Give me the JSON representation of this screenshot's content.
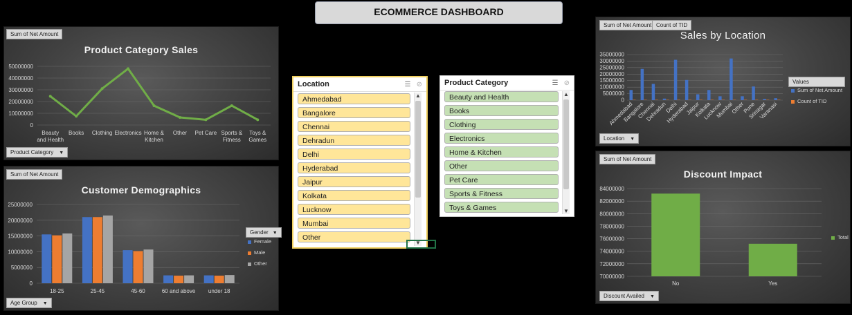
{
  "dashboard_title": "ECOMMERCE DASHBOARD",
  "colors": {
    "female": "#4472c4",
    "male": "#ed7d31",
    "other": "#a5a5a5",
    "line": "#70ad47",
    "bar_green": "#70ad47",
    "location_bar": "#4472c4",
    "count_tid": "#ed7d31",
    "slicer_location": "#ffe699",
    "slicer_category": "#c5e0b4"
  },
  "product_chart": {
    "field_button": "Sum of Net Amount",
    "title": "Product Category Sales",
    "filter_button": "Product Category",
    "y_ticks": [
      "50000000",
      "40000000",
      "30000000",
      "20000000",
      "10000000",
      "0"
    ],
    "x_labels": [
      [
        "Beauty",
        "and Health"
      ],
      [
        "Books"
      ],
      [
        "Clothing"
      ],
      [
        "Electronics"
      ],
      [
        "Home &",
        "Kitchen"
      ],
      [
        "Other"
      ],
      [
        "Pet Care"
      ],
      [
        "Sports &",
        "Fitness"
      ],
      [
        "Toys &",
        "Games"
      ]
    ]
  },
  "demographics_chart": {
    "field_button": "Sum of Net Amount",
    "title": "Customer Demographics",
    "filter_button": "Age Group",
    "legend_title": "Gender",
    "legend": [
      "Female",
      "Male",
      "Other"
    ],
    "y_ticks": [
      "25000000",
      "20000000",
      "15000000",
      "10000000",
      "5000000",
      "0"
    ],
    "x_labels": [
      "18-25",
      "25-45",
      "45-60",
      "60 and above",
      "under 18"
    ]
  },
  "location_chart": {
    "field_button_1": "Sum of Net Amount",
    "field_button_2": "Count of TID",
    "title": "Sales by Location",
    "filter_button": "Location",
    "legend_title": "Values",
    "legend": [
      "Sum of Net Amount",
      "Count of TID"
    ],
    "y_ticks": [
      "35000000",
      "30000000",
      "25000000",
      "20000000",
      "15000000",
      "10000000",
      "5000000",
      "0"
    ],
    "x_labels": [
      "Ahmedabad",
      "Bangalore",
      "Chennai",
      "Dehradun",
      "Delhi",
      "Hyderabad",
      "Jaipur",
      "Kolkata",
      "Lucknow",
      "Mumbai",
      "Other",
      "Pune",
      "Srinagar",
      "Varanasi"
    ]
  },
  "discount_chart": {
    "field_button": "Sum of Net Amount",
    "title": "Discount Impact",
    "filter_button": "Discount Availed",
    "legend": [
      "Total"
    ],
    "y_ticks": [
      "84000000",
      "82000000",
      "80000000",
      "78000000",
      "76000000",
      "74000000",
      "72000000",
      "70000000"
    ],
    "x_labels": [
      "No",
      "Yes"
    ]
  },
  "location_slicer": {
    "title": "Location",
    "items": [
      "Ahmedabad",
      "Bangalore",
      "Chennai",
      "Dehradun",
      "Delhi",
      "Hyderabad",
      "Jaipur",
      "Kolkata",
      "Lucknow",
      "Mumbai",
      "Other"
    ]
  },
  "category_slicer": {
    "title": "Product Category",
    "items": [
      "Beauty and Health",
      "Books",
      "Clothing",
      "Electronics",
      "Home & Kitchen",
      "Other",
      "Pet Care",
      "Sports & Fitness",
      "Toys & Games"
    ]
  },
  "chart_data": [
    {
      "type": "line",
      "title": "Product Category Sales",
      "categories": [
        "Beauty and Health",
        "Books",
        "Clothing",
        "Electronics",
        "Home & Kitchen",
        "Other",
        "Pet Care",
        "Sports & Fitness",
        "Toys & Games"
      ],
      "values": [
        24500000,
        7500000,
        31000000,
        48000000,
        16500000,
        6500000,
        4500000,
        16500000,
        4500000
      ],
      "ylim": [
        0,
        50000000
      ],
      "grid": true
    },
    {
      "type": "bar",
      "title": "Customer Demographics",
      "categories": [
        "18-25",
        "25-45",
        "45-60",
        "60 and above",
        "under 18"
      ],
      "series": [
        {
          "name": "Female",
          "values": [
            15500000,
            21000000,
            10500000,
            2500000,
            2500000
          ]
        },
        {
          "name": "Male",
          "values": [
            15200000,
            21000000,
            10200000,
            2400000,
            2400000
          ]
        },
        {
          "name": "Other",
          "values": [
            15800000,
            21500000,
            10700000,
            2500000,
            2600000
          ]
        }
      ],
      "ylim": [
        0,
        25000000
      ],
      "grid": true
    },
    {
      "type": "bar",
      "title": "Sales by Location",
      "categories": [
        "Ahmedabad",
        "Bangalore",
        "Chennai",
        "Dehradun",
        "Delhi",
        "Hyderabad",
        "Jaipur",
        "Kolkata",
        "Lucknow",
        "Mumbai",
        "Other",
        "Pune",
        "Srinagar",
        "Varanasi"
      ],
      "series": [
        {
          "name": "Sum of Net Amount",
          "values": [
            7800000,
            24000000,
            12500000,
            1200000,
            31000000,
            15500000,
            4500000,
            7800000,
            3000000,
            32000000,
            3000000,
            10500000,
            1000000,
            1500000
          ]
        },
        {
          "name": "Count of TID",
          "values": [
            100,
            300,
            150,
            15,
            380,
            190,
            55,
            95,
            40,
            390,
            40,
            130,
            12,
            20
          ]
        }
      ],
      "ylim": [
        0,
        35000000
      ],
      "grid": true
    },
    {
      "type": "bar",
      "title": "Discount Impact",
      "categories": [
        "No",
        "Yes"
      ],
      "series": [
        {
          "name": "Total",
          "values": [
            83200000,
            75200000
          ]
        }
      ],
      "ylim": [
        70000000,
        84000000
      ],
      "grid": true
    }
  ]
}
